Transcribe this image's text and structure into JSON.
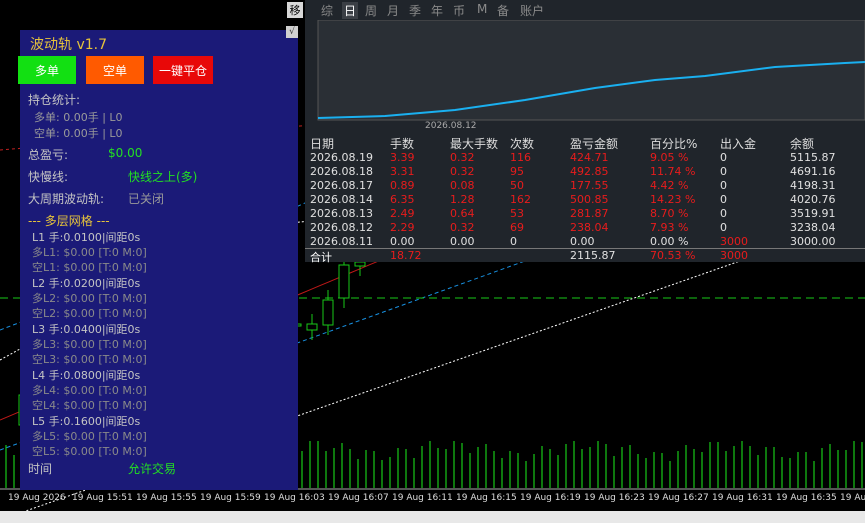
{
  "panel": {
    "title": "波动轨 v1.7",
    "buttons": {
      "long": "多单",
      "short": "空单",
      "close_all": "一键平仓"
    },
    "position_stats_label": "持仓统计:",
    "long_position": "多单: 0.00手 | L0",
    "short_position": "空单: 0.00手 | L0",
    "total_pnl_label": "总盈亏:",
    "total_pnl_value": "$0.00",
    "fast_slow_label": "快慢线:",
    "fast_slow_value": "快线之上(多)",
    "big_cycle_label": "大周期波动轨:",
    "big_cycle_value": "已关闭",
    "grid_title": "--- 多层网格 ---",
    "levels": [
      {
        "lot": "L1 手:0.0100|间距0s",
        "long": "多L1: $0.00 [T:0 M:0]",
        "short": "空L1: $0.00 [T:0 M:0]"
      },
      {
        "lot": "L2 手:0.0200|间距0s",
        "long": "多L2: $0.00 [T:0 M:0]",
        "short": "空L2: $0.00 [T:0 M:0]"
      },
      {
        "lot": "L3 手:0.0400|间距0s",
        "long": "多L3: $0.00 [T:0 M:0]",
        "short": "空L3: $0.00 [T:0 M:0]"
      },
      {
        "lot": "L4 手:0.0800|间距0s",
        "long": "多L4: $0.00 [T:0 M:0]",
        "short": "空L4: $0.00 [T:0 M:0]"
      },
      {
        "lot": "L5 手:0.1600|间距0s",
        "long": "多L5: $0.00 [T:0 M:0]",
        "short": "空L5: $0.00 [T:0 M:0]"
      }
    ],
    "time_label": "时间",
    "trade_status": "允许交易",
    "collapse_icon": "√"
  },
  "stats": {
    "tabs": [
      "综",
      "日",
      "周",
      "月",
      "季",
      "年",
      "币",
      "M",
      "备",
      "账户"
    ],
    "active_tab": 1,
    "chart_date_label": "2026.08.12",
    "headers": [
      "日期",
      "手数",
      "最大手数",
      "次数",
      "盈亏金额",
      "百分比%",
      "出入金",
      "余额"
    ],
    "rows": [
      [
        "2026.08.19",
        "3.39",
        "0.32",
        "116",
        "424.71",
        "9.05 %",
        "0",
        "5115.87"
      ],
      [
        "2026.08.18",
        "3.31",
        "0.32",
        "95",
        "492.85",
        "11.74 %",
        "0",
        "4691.16"
      ],
      [
        "2026.08.17",
        "0.89",
        "0.08",
        "50",
        "177.55",
        "4.42 %",
        "0",
        "4198.31"
      ],
      [
        "2026.08.14",
        "6.35",
        "1.28",
        "162",
        "500.85",
        "14.23 %",
        "0",
        "4020.76"
      ],
      [
        "2026.08.13",
        "2.49",
        "0.64",
        "53",
        "281.87",
        "8.70 %",
        "0",
        "3519.91"
      ],
      [
        "2026.08.12",
        "2.29",
        "0.32",
        "69",
        "238.04",
        "7.93 %",
        "0",
        "3238.04"
      ],
      [
        "2026.08.11",
        "0.00",
        "0.00",
        "0",
        "0.00",
        "0.00 %",
        "3000",
        "3000.00"
      ]
    ],
    "total": [
      "合计",
      "18.72",
      "",
      "",
      "2115.87",
      "70.53 %",
      "3000",
      ""
    ]
  },
  "axis": {
    "x_labels": [
      "19 Aug 2026",
      "19 Aug 15:51",
      "19 Aug 15:55",
      "19 Aug 15:59",
      "19 Aug 16:03",
      "19 Aug 16:07",
      "19 Aug 16:11",
      "19 Aug 16:15",
      "19 Aug 16:19",
      "19 Aug 16:23",
      "19 Aug 16:27",
      "19 Aug 16:31",
      "19 Aug 16:35",
      "19 Aug"
    ]
  },
  "corner_icon": "移",
  "colors": {
    "up": "#00c800",
    "accent_panel": "#1b1a78",
    "red": "#e81c1c",
    "gold": "#e6c33b"
  }
}
